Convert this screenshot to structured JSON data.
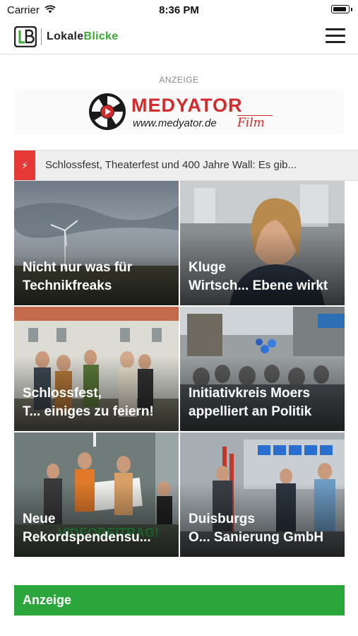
{
  "status_bar": {
    "carrier": "Carrier",
    "time": "8:36 PM"
  },
  "header": {
    "logo_text_part1": "Lokale",
    "logo_text_part2": "Blicke"
  },
  "ad": {
    "label": "ANZEIGE",
    "brand": "MEDYATOR",
    "url": "www.medyator.de",
    "tagline": "Film"
  },
  "ticker": {
    "icon": "lightning-icon",
    "text": "Schlossfest, Theaterfest und 400 Jahre Wall: Es gib..."
  },
  "articles": [
    {
      "line1": "Nicht nur was für",
      "line2": "Technikfreaks"
    },
    {
      "line1": "Kluge",
      "line2": "Wirtsch... Ebene wirkt"
    },
    {
      "line1": "Schlossfest,",
      "line2": "T... einiges zu feiern!"
    },
    {
      "line1": "Initiativkreis Moers",
      "line2": "appelliert an Politik"
    },
    {
      "line1": "Neue",
      "line2": "Rekordspendensu..."
    },
    {
      "line1": "Duisburgs",
      "line2": "O... Sanierung GmbH"
    }
  ],
  "bottom_ad": {
    "label": "Anzeige"
  },
  "colors": {
    "accent_green": "#2aa63a",
    "ticker_red": "#e53935",
    "brand_red": "#d32b2b"
  }
}
